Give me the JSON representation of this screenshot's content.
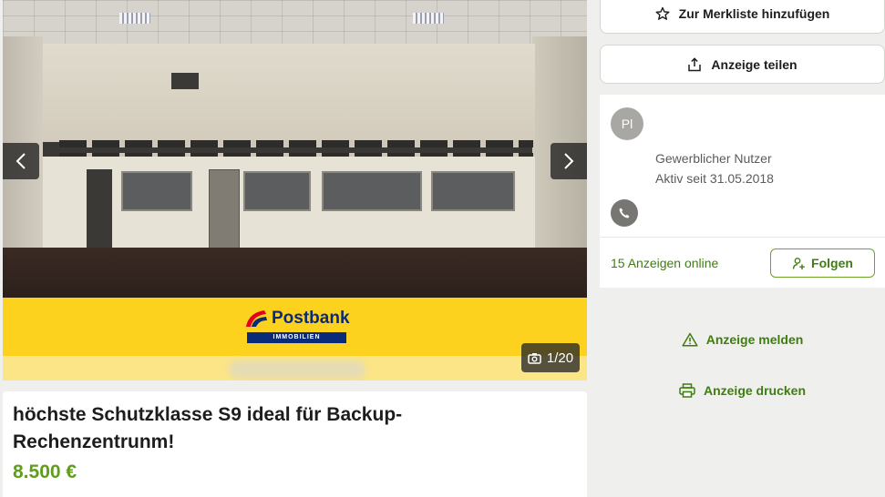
{
  "gallery": {
    "counter": "1/20",
    "logo_word": "Postbank",
    "logo_sub": "IMMOBILIEN",
    "prev_icon": "chevron-left-icon",
    "next_icon": "chevron-right-icon",
    "camera_icon": "camera-icon"
  },
  "listing": {
    "title": "höchste Schutzklasse S9 ideal für Backup-Rechenzentrunm!",
    "price": "8.500 €"
  },
  "sidebar": {
    "watchlist_label": "Zur Merkliste hinzufügen",
    "share_label": "Anzeige teilen",
    "seller": {
      "initials": "Pl",
      "user_type": "Gewerblicher Nutzer",
      "active_since": "Aktiv seit 31.05.2018",
      "ads_online": "15 Anzeigen online",
      "follow_label": "Folgen"
    },
    "report_label": "Anzeige melden",
    "print_label": "Anzeige drucken"
  },
  "colors": {
    "accent_green": "#3f7d11",
    "price_green": "#5e9f1a",
    "brand_yellow": "#fdd21f",
    "brand_blue": "#0a2a7a"
  }
}
